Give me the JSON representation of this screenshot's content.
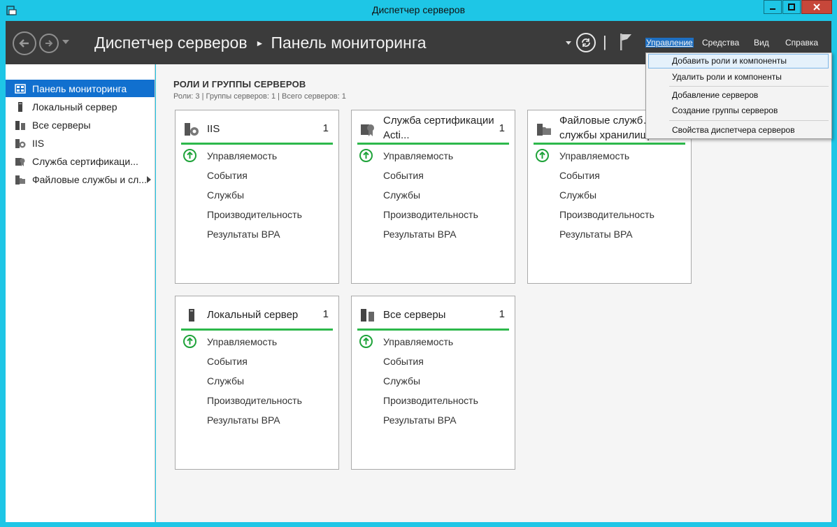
{
  "window": {
    "title": "Диспетчер серверов"
  },
  "header": {
    "breadcrumb_root": "Диспетчер серверов",
    "breadcrumb_current": "Панель мониторинга",
    "pipe": "|",
    "menus": [
      "Управление",
      "Средства",
      "Вид",
      "Справка"
    ]
  },
  "sidebar": {
    "items": [
      {
        "label": "Панель мониторинга",
        "icon": "dashboard-icon",
        "selected": true
      },
      {
        "label": "Локальный сервер",
        "icon": "server-icon"
      },
      {
        "label": "Все серверы",
        "icon": "servers-icon"
      },
      {
        "label": "IIS",
        "icon": "iis-icon"
      },
      {
        "label": "Служба сертификаци...",
        "icon": "certificate-icon"
      },
      {
        "label": "Файловые службы и сл...",
        "icon": "file-services-icon",
        "has_submenu": true
      }
    ]
  },
  "main": {
    "section_title": "РОЛИ И ГРУППЫ СЕРВЕРОВ",
    "section_subtitle": "Роли: 3 | Группы серверов: 1 | Всего серверов: 1",
    "tile_rows": [
      "Управляемость",
      "События",
      "Службы",
      "Производительность",
      "Результаты BPA"
    ],
    "tiles": [
      {
        "title": "IIS",
        "count": "1",
        "icon": "iis-icon"
      },
      {
        "title": "Служба сертификации Acti...",
        "count": "1",
        "icon": "certificate-icon"
      },
      {
        "title": "Файловые служб… службы хранилищ…",
        "count": "",
        "icon": "file-services-icon"
      },
      {
        "title": "Локальный сервер",
        "count": "1",
        "icon": "server-icon"
      },
      {
        "title": "Все серверы",
        "count": "1",
        "icon": "servers-icon"
      }
    ]
  },
  "dropdown": {
    "items": [
      "Добавить роли и компоненты",
      "Удалить роли и компоненты",
      "Добавление серверов",
      "Создание группы серверов",
      "Свойства диспетчера серверов"
    ]
  },
  "colors": {
    "header_bg": "#3b3b3b",
    "accent_blue": "#1170cf",
    "ok_green": "#2db84b",
    "frame_cyan": "#1ec6e6"
  }
}
